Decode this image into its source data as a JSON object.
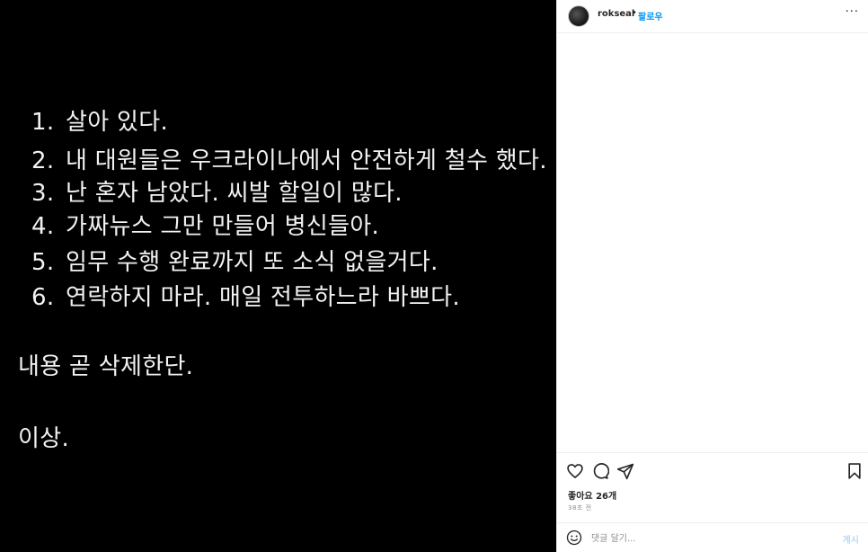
{
  "post_image": {
    "list": [
      {
        "num": "1.",
        "text": "살아 있다."
      },
      {
        "num": "2.",
        "text": "내 대원들은 우크라이나에서 안전하게 철수 했다."
      },
      {
        "num": "3.",
        "text": "난 혼자 남았다. 씨발 할일이 많다."
      },
      {
        "num": "4.",
        "text": "가짜뉴스 그만 만들어 병신들아."
      },
      {
        "num": "5.",
        "text": "임무 수행 완료까지 또 소식 없을거다."
      },
      {
        "num": "6.",
        "text": "연락하지 마라. 매일 전투하느라 바쁘다."
      }
    ],
    "note": "내용 곧 삭제한단.",
    "closing": "이상."
  },
  "header": {
    "username": "rokseal",
    "separator": "•",
    "follow_label": "팔로우",
    "more_label": "···"
  },
  "actions": {
    "heart_icon": "heart-icon",
    "comment_icon": "comment-icon",
    "share_icon": "share-icon",
    "save_icon": "bookmark-icon"
  },
  "likes_text": "좋아요 26개",
  "timestamp": "38초 전",
  "comment_bar": {
    "placeholder": "댓글 달기...",
    "post_label": "게시"
  },
  "colors": {
    "link": "#0095f6",
    "post_disabled": "#b3dbff",
    "image_bg": "#000000"
  }
}
